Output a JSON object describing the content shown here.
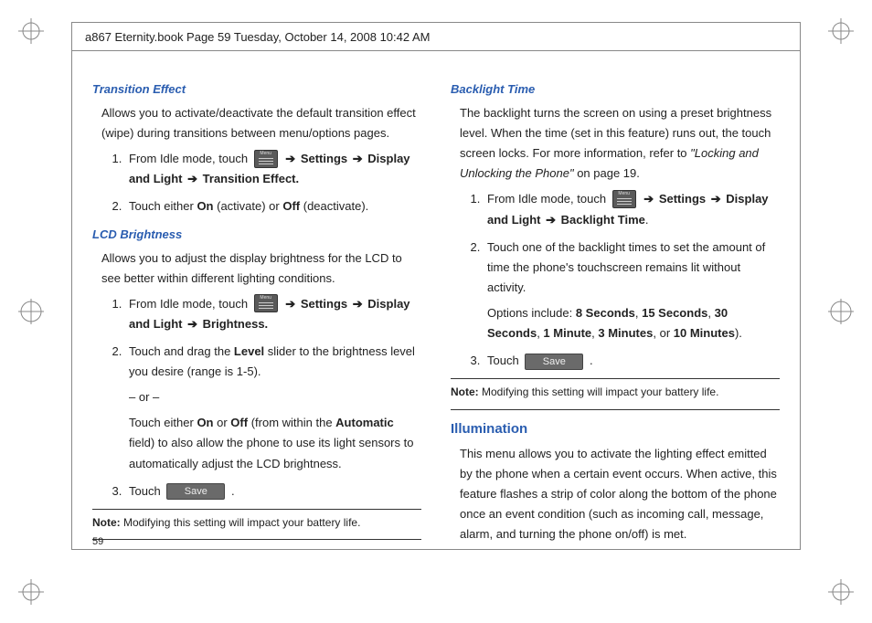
{
  "header_info": "a867 Eternity.book  Page 59  Tuesday, October 14, 2008  10:42 AM",
  "page_number": "59",
  "arrow": "➔",
  "icons": {
    "menu": "menu-icon",
    "save": "Save"
  },
  "left": {
    "section1": {
      "title": "Transition Effect",
      "intro": "Allows you to activate/deactivate the default transition effect (wipe) during transitions between menu/options pages.",
      "step1_a": "From Idle mode, touch ",
      "step1_b1": "Settings",
      "step1_b2": "Display and Light",
      "step1_b3": "Transition Effect.",
      "step2_a": "Touch either ",
      "step2_on": "On",
      "step2_mid1": " (activate) or ",
      "step2_off": "Off",
      "step2_mid2": " (deactivate)."
    },
    "section2": {
      "title": "LCD Brightness",
      "intro": "Allows you to adjust the display brightness for the LCD to see better within different lighting conditions.",
      "step1_a": "From Idle mode, touch ",
      "step1_b1": "Settings",
      "step1_b2": "Display and Light",
      "step1_b3": "Brightness.",
      "step2_a": "Touch and drag the ",
      "step2_level": "Level",
      "step2_b": " slider to the brightness level you desire (range is 1-5).",
      "step2_or": "– or –",
      "step2_c1": "Touch either ",
      "step2_on": "On",
      "step2_c2": " or ",
      "step2_off": "Off",
      "step2_c3": " (from within the ",
      "step2_auto": "Automatic",
      "step2_c4": " field) to also allow the phone to use its light sensors to automatically adjust the LCD brightness.",
      "step3_a": "Touch ",
      "step3_b": "."
    },
    "note_label": "Note:",
    "note_text": " Modifying this setting will impact your battery life."
  },
  "right": {
    "section1": {
      "title": "Backlight Time",
      "intro_a": "The backlight turns the screen on using a preset brightness level. When the time (set in this feature) runs out, the touch screen locks. For more information, refer to ",
      "intro_ref": "\"Locking and Unlocking the Phone\"",
      "intro_b": "  on page 19.",
      "step1_a": "From Idle mode, touch ",
      "step1_b1": "Settings",
      "step1_b2": "Display and Light",
      "step1_b3": "Backlight Time",
      "step1_end": ".",
      "step2_a": "Touch one of the backlight times to set the amount of time the phone's touchscreen remains lit without activity.",
      "step2_opts_a": "Options include: ",
      "opt1": "8 Seconds",
      "c1": ", ",
      "opt2": "15 Seconds",
      "c2": ", ",
      "opt3": "30 Seconds",
      "c3": ", ",
      "opt4": "1 Minute",
      "c4": ", ",
      "opt5": "3 Minutes",
      "c5": ", or ",
      "opt6": "10 Minutes",
      "step2_opts_end": ").",
      "step3_a": "Touch ",
      "step3_b": "."
    },
    "note_label": "Note:",
    "note_text": " Modifying this setting will impact your battery life.",
    "section2": {
      "title": "Illumination",
      "intro": "This menu allows you to activate the lighting effect emitted by the phone when a certain event occurs. When active, this feature flashes a strip of color along the bottom of the phone once an event condition (such as incoming call, message, alarm, and turning the phone on/off) is met."
    }
  }
}
